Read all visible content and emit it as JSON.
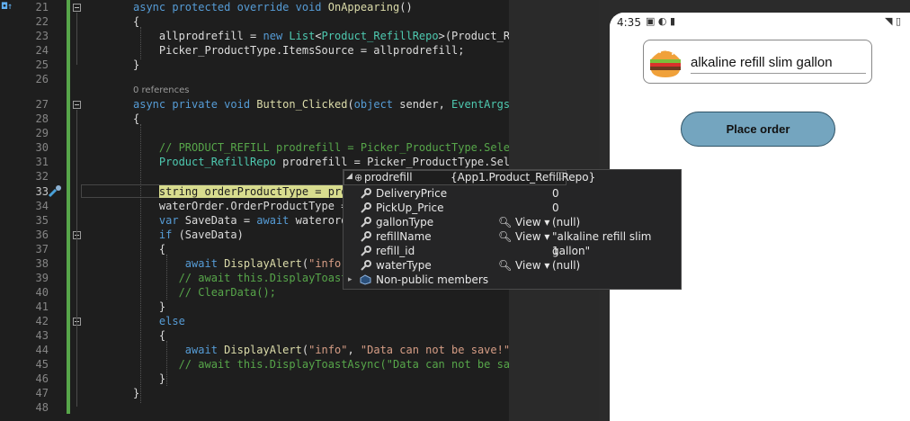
{
  "editor": {
    "lines": [
      {
        "num": "21",
        "parts": [
          [
            "kw",
            "async protected override void "
          ],
          [
            "fn",
            "OnAppearing"
          ],
          [
            "",
            "()"
          ]
        ]
      },
      {
        "num": "22",
        "parts": [
          [
            "",
            "{"
          ]
        ]
      },
      {
        "num": "23",
        "parts": [
          [
            "",
            "    allprodrefill = "
          ],
          [
            "kw",
            "new "
          ],
          [
            "ty",
            "List"
          ],
          [
            "",
            "<"
          ],
          [
            "ty",
            "Product_RefillRepo"
          ],
          [
            "",
            "&gt;(Product_Ref"
          ]
        ]
      },
      {
        "num": "24",
        "parts": [
          [
            "",
            "    Picker_ProductType.ItemsSource = allprodrefill;"
          ]
        ]
      },
      {
        "num": "25",
        "parts": [
          [
            "",
            "}"
          ]
        ]
      },
      {
        "num": "26",
        "parts": []
      },
      {
        "num": "27",
        "parts": [
          [
            "kw",
            "async private void "
          ],
          [
            "fn",
            "Button_Clicked"
          ],
          [
            "",
            "("
          ],
          [
            "kw",
            "object "
          ],
          [
            "",
            "sender, "
          ],
          [
            "ty",
            "EventArgs "
          ],
          [
            "",
            "e"
          ]
        ]
      },
      {
        "num": "28",
        "parts": [
          [
            "",
            "{"
          ]
        ]
      },
      {
        "num": "29",
        "parts": []
      },
      {
        "num": "30",
        "parts": [
          [
            "cm",
            "    // PRODUCT_REFILL prodrefill = Picker_ProductType.Select"
          ]
        ]
      },
      {
        "num": "31",
        "parts": [
          [
            "ty",
            "    Product_RefillRepo "
          ],
          [
            "",
            "prodrefill = Picker_ProductType.Selec"
          ]
        ]
      },
      {
        "num": "32",
        "parts": []
      },
      {
        "num": "33",
        "parts": [
          [
            "",
            "    "
          ],
          [
            "hl",
            "string orderProductType = pro"
          ]
        ]
      },
      {
        "num": "34",
        "parts": [
          [
            "",
            "    waterOrder.OrderProductType = "
          ]
        ]
      },
      {
        "num": "35",
        "parts": [
          [
            "kw",
            "    var "
          ],
          [
            "",
            "SaveData = "
          ],
          [
            "kw",
            "await "
          ],
          [
            "",
            "waterorde"
          ]
        ]
      },
      {
        "num": "36",
        "parts": [
          [
            "kw",
            "    if "
          ],
          [
            "",
            "(SaveData)"
          ]
        ]
      },
      {
        "num": "37",
        "parts": [
          [
            "",
            "    {"
          ]
        ]
      },
      {
        "num": "38",
        "parts": [
          [
            "",
            "        "
          ],
          [
            "kw",
            "await "
          ],
          [
            "fn",
            "DisplayAlert"
          ],
          [
            "",
            "("
          ],
          [
            "st",
            "\"info\""
          ],
          [
            "",
            ","
          ]
        ]
      },
      {
        "num": "39",
        "parts": [
          [
            "cm",
            "       // await this.DisplayToast"
          ]
        ]
      },
      {
        "num": "40",
        "parts": [
          [
            "cm",
            "       // ClearData();"
          ]
        ]
      },
      {
        "num": "41",
        "parts": [
          [
            "",
            "    }"
          ]
        ]
      },
      {
        "num": "42",
        "parts": [
          [
            "kw",
            "    else"
          ]
        ]
      },
      {
        "num": "43",
        "parts": [
          [
            "",
            "    {"
          ]
        ]
      },
      {
        "num": "44",
        "parts": [
          [
            "",
            "        "
          ],
          [
            "kw",
            "await "
          ],
          [
            "fn",
            "DisplayAlert"
          ],
          [
            "",
            "("
          ],
          [
            "st",
            "\"info\""
          ],
          [
            "",
            ", "
          ],
          [
            "st",
            "\"Data can not be save!\""
          ],
          [
            "",
            ","
          ]
        ]
      },
      {
        "num": "45",
        "parts": [
          [
            "cm",
            "       // await this.DisplayToastAsync(\"Data can not be save"
          ]
        ]
      },
      {
        "num": "46",
        "parts": [
          [
            "",
            "    }"
          ]
        ]
      },
      {
        "num": "47",
        "parts": [
          [
            "",
            "}"
          ]
        ]
      },
      {
        "num": "48",
        "parts": []
      }
    ],
    "references_label": "0 references",
    "current_line": "33"
  },
  "datatip": {
    "header_name": "prodrefill",
    "header_type": "{App1.Product_RefillRepo}",
    "rows": [
      {
        "name": "DeliveryPrice",
        "value": "0",
        "view": ""
      },
      {
        "name": "PickUp_Price",
        "value": "0",
        "view": ""
      },
      {
        "name": "gallonType",
        "value": "(null)",
        "view": "View"
      },
      {
        "name": "refillName",
        "value": "\"alkaline refill slim gallon\"",
        "view": "View"
      },
      {
        "name": "refill_id",
        "value": "1",
        "view": ""
      },
      {
        "name": "waterType",
        "value": "(null)",
        "view": "View"
      }
    ],
    "nonpublic_label": "Non-public members"
  },
  "phone": {
    "status_time": "4:35",
    "picker_value": "alkaline refill slim gallon",
    "order_button": "Place order"
  },
  "colors": {
    "accent_button": "#74a5bf",
    "editor_bg": "#1e1e1e",
    "change_bar": "#57a64a"
  }
}
